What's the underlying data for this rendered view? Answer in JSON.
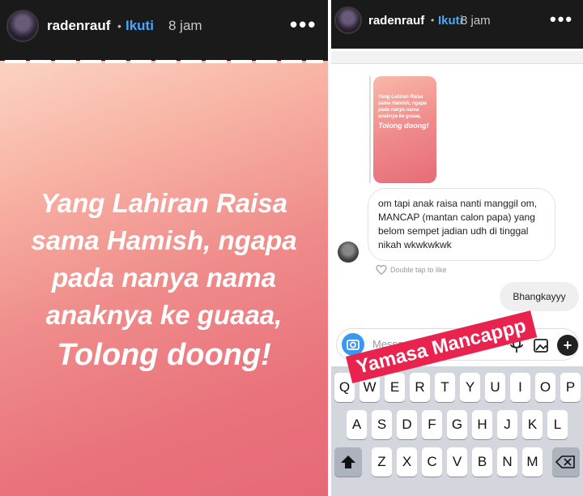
{
  "left_story": {
    "username": "radenrauf",
    "separator": "•",
    "follow_label": "Ikuti",
    "time": "8 jam",
    "more_label": "•••",
    "text_lines": [
      "Yang Lahiran Raisa",
      "sama Hamish, ngapa",
      "pada nanya nama",
      "anaknya ke guaaa,"
    ],
    "text_big": "Tolong doong!"
  },
  "right_story": {
    "username": "radenrauf",
    "separator": "•",
    "follow_label": "Ikuti",
    "time": "8 jam",
    "more_label": "•••",
    "thumb_text": "Yang Lahiran Raisa sama Hamish, ngapa pada nanya nama anaknya ke guaaa,",
    "thumb_big": "Tolong doong!",
    "incoming_message": "om tapi anak raisa nanti manggil om, MANCAP (mantan calon papa) yang belom sempet jadian udh di tinggal nikah wkwkwkwk",
    "like_hint": "Double tap to like",
    "outgoing_message": "Bhangkayyy",
    "message_placeholder": "Message...",
    "plus_label": "+",
    "sticker_text": "Yamasa Mancappp",
    "keyboard_row1": [
      "Q",
      "W",
      "E",
      "R",
      "T",
      "Y",
      "U",
      "I",
      "O",
      "P"
    ],
    "keyboard_row2": [
      "A",
      "S",
      "D",
      "F",
      "G",
      "H",
      "J",
      "K",
      "L"
    ],
    "keyboard_row3": [
      "Z",
      "X",
      "C",
      "V",
      "B",
      "N",
      "M"
    ]
  },
  "colors": {
    "follow_blue": "#4ea6f5",
    "sticker_red": "#e8234e",
    "camera_blue": "#3897f0"
  }
}
